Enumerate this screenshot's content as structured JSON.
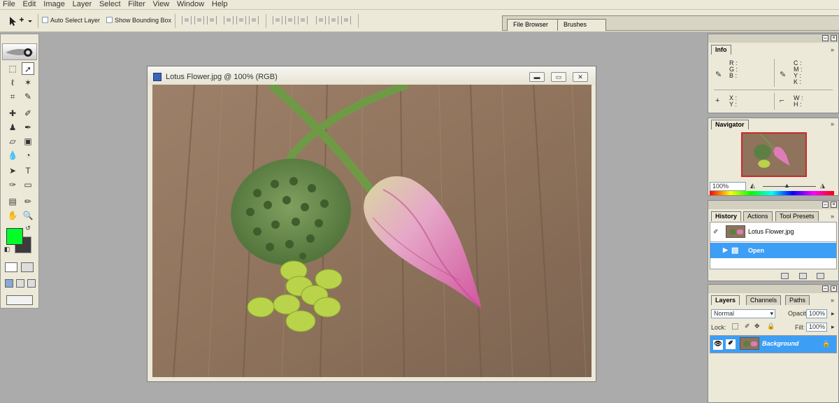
{
  "menu": [
    "File",
    "Edit",
    "Image",
    "Layer",
    "Select",
    "Filter",
    "View",
    "Window",
    "Help"
  ],
  "options": {
    "auto_select": "Auto Select Layer",
    "show_bbox": "Show Bounding Box"
  },
  "well_tabs": [
    "File Browser",
    "Brushes"
  ],
  "colors": {
    "foreground": "#00ff2a",
    "background": "#3c3c3c",
    "accent": "#3c9ef5"
  },
  "document": {
    "title": "Lotus Flower.jpg @ 100% (RGB)",
    "buttons": [
      "minimize",
      "maximize",
      "close"
    ]
  },
  "info": {
    "tab": "Info",
    "rgb": [
      "R :",
      "G :",
      "B :"
    ],
    "cmyk": [
      "C :",
      "M :",
      "Y :",
      "K :"
    ],
    "xy": [
      "X :",
      "Y :"
    ],
    "wh": [
      "W :",
      "H :"
    ]
  },
  "navigator": {
    "tab": "Navigator",
    "zoom": "100%"
  },
  "history": {
    "tabs": [
      "History",
      "Actions",
      "Tool Presets"
    ],
    "snapshot": "Lotus Flower.jpg",
    "states": [
      "Open"
    ]
  },
  "layers": {
    "tabs": [
      "Layers",
      "Channels",
      "Paths"
    ],
    "blend_mode": "Normal",
    "opacity_label": "Opacity:",
    "opacity": "100%",
    "lock_label": "Lock:",
    "fill_label": "Fill:",
    "fill": "100%",
    "layer_name": "Background"
  }
}
